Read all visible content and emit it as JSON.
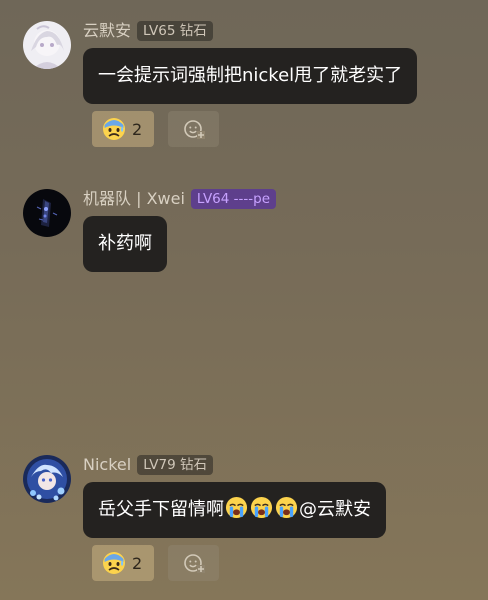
{
  "messages": [
    {
      "username": "云默安",
      "level": "LV65 钻石",
      "text": "一会提示词强制把nickel甩了就老实了",
      "reaction": {
        "emoji": "fearful-sweat-face",
        "count": "2"
      }
    },
    {
      "username": "机器队 | Xwei",
      "level": "LV64 ----pe",
      "text": "补药啊"
    },
    {
      "username": "Nickel",
      "level": "LV79 钻石",
      "text_main": "岳父手下留情啊",
      "text_emojis": [
        "loudly-crying-face",
        "loudly-crying-face",
        "loudly-crying-face"
      ],
      "text_mention": "@云默安",
      "reaction": {
        "emoji": "fearful-sweat-face",
        "count": "2"
      }
    }
  ],
  "colors": {
    "bubble": "#242220",
    "badge_purple": "#5e3f8c",
    "reaction_pill": "#c8b082"
  }
}
